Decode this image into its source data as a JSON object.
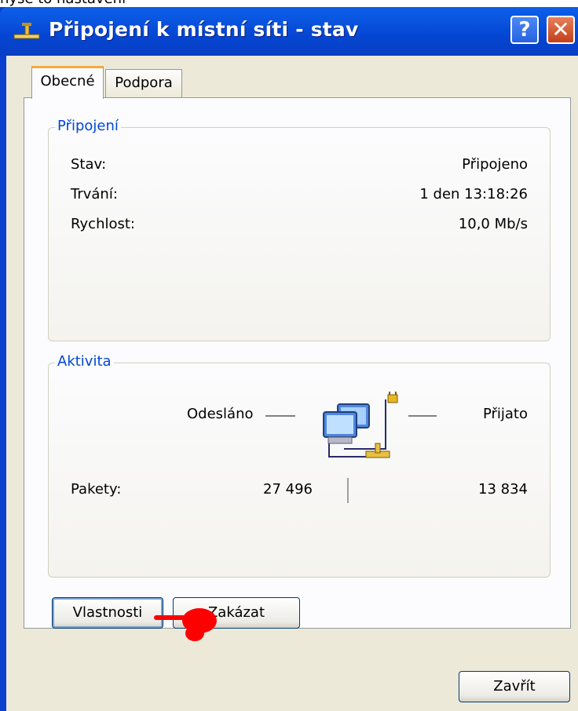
{
  "top_strip_text": "nyse to nastavení",
  "window": {
    "title": "Připojení k místní síti - stav",
    "help_label": "?",
    "close_label": "✕"
  },
  "tabs": [
    {
      "label": "Obecné",
      "active": true
    },
    {
      "label": "Podpora",
      "active": false
    }
  ],
  "connection": {
    "legend": "Připojení",
    "rows": [
      {
        "label": "Stav:",
        "value": "Připojeno"
      },
      {
        "label": "Trvání:",
        "value": "1 den 13:18:26"
      },
      {
        "label": "Rychlost:",
        "value": "10,0 Mb/s"
      }
    ]
  },
  "activity": {
    "legend": "Aktivita",
    "sent_label": "Odesláno",
    "received_label": "Přijato",
    "packets_label": "Pakety:",
    "packets_sent": "27 496",
    "packets_received": "13 834",
    "icon": "network-computers-icon"
  },
  "buttons": {
    "properties": "Vlastnosti",
    "disable": "Zakázat",
    "close": "Zavřít"
  },
  "colors": {
    "title_bar": "#0a56e0",
    "legend_text": "#0046d5",
    "tab_highlight": "#f3a93e",
    "annotation_pointer": "#ff0000"
  }
}
